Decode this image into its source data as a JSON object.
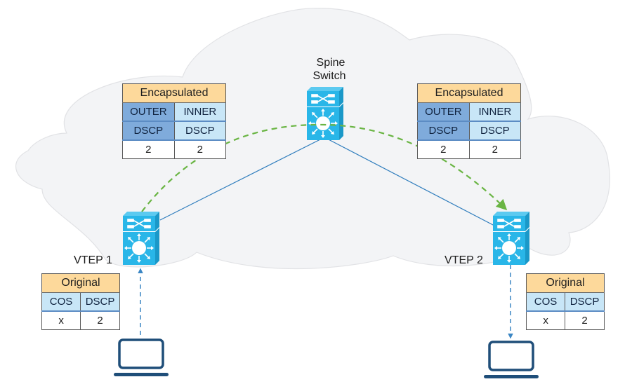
{
  "nodes": {
    "spine": {
      "label_line1": "Spine",
      "label_line2": "Switch"
    },
    "vtep1": {
      "label": "VTEP 1"
    },
    "vtep2": {
      "label": "VTEP 2"
    }
  },
  "tables": {
    "encapsulated_left": {
      "title": "Encapsulated",
      "columns": [
        {
          "line1": "OUTER",
          "line2": "DSCP",
          "value": "2"
        },
        {
          "line1": "INNER",
          "line2": "DSCP",
          "value": "2"
        }
      ]
    },
    "encapsulated_right": {
      "title": "Encapsulated",
      "columns": [
        {
          "line1": "OUTER",
          "line2": "DSCP",
          "value": "2"
        },
        {
          "line1": "INNER",
          "line2": "DSCP",
          "value": "2"
        }
      ]
    },
    "original_left": {
      "title": "Original",
      "columns": [
        {
          "header": "COS",
          "value": "x"
        },
        {
          "header": "DSCP",
          "value": "2"
        }
      ]
    },
    "original_right": {
      "title": "Original",
      "columns": [
        {
          "header": "COS",
          "value": "x"
        },
        {
          "header": "DSCP",
          "value": "2"
        }
      ]
    }
  },
  "colors": {
    "cloud_fill": "#f3f4f6",
    "cloud_stroke": "#e1e2e5",
    "switch_fill": "#29b6e8",
    "link_line": "#2f7dbd",
    "overlay_path": "#6ab544",
    "host_path": "#3b86c4",
    "host_icon": "#1f4e79",
    "title_fill": "#fdd99b",
    "outer_fill": "#7fabdb",
    "inner_fill": "#c8e6f7"
  },
  "icons": {
    "spine": "multilayer-switch-icon",
    "vtep1": "multilayer-switch-icon",
    "vtep2": "multilayer-switch-icon",
    "host1": "laptop-icon",
    "host2": "laptop-icon"
  }
}
